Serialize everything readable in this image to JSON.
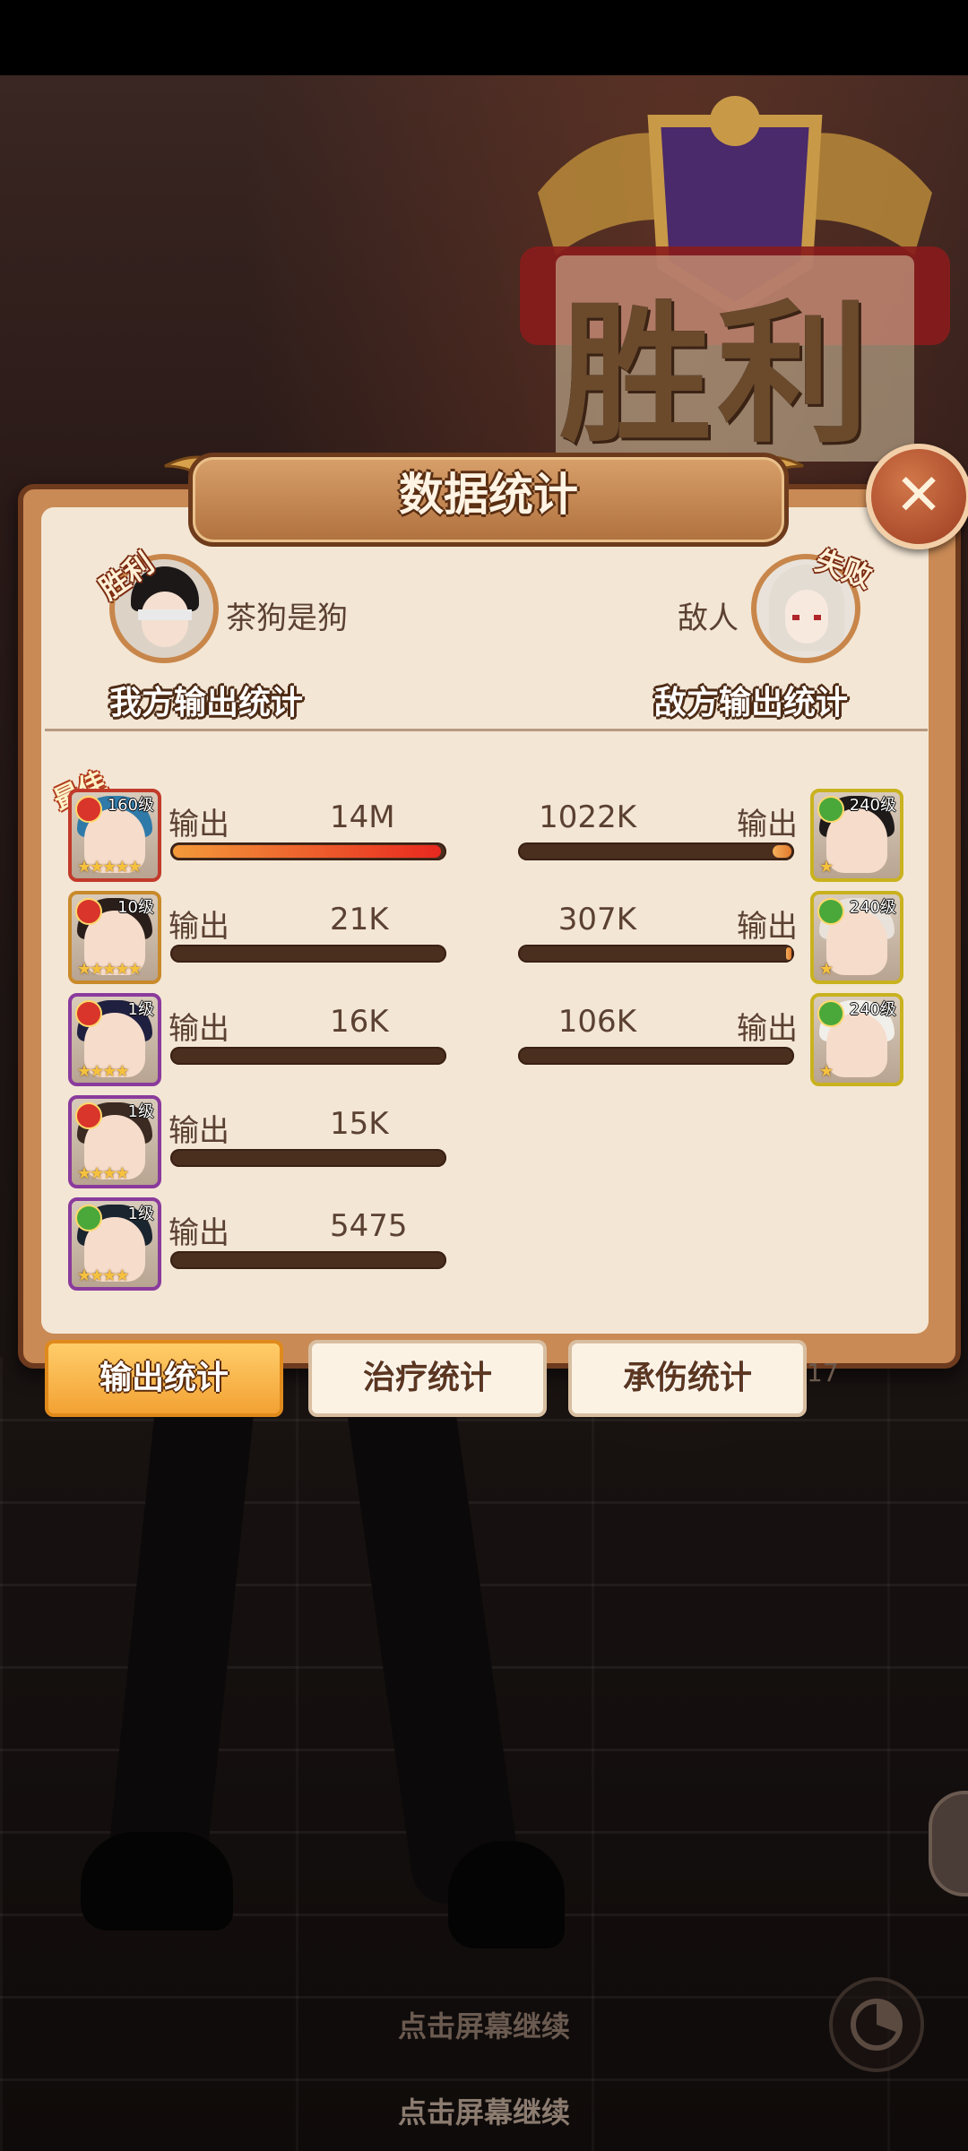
{
  "header": {
    "victory_text": "胜利",
    "panel_title": "数据统计",
    "close_symbol": "✕"
  },
  "players": {
    "ally": {
      "name": "茶狗是狗",
      "badge": "胜利",
      "section_title": "我方输出统计"
    },
    "enemy": {
      "name": "敌人",
      "badge": "失败",
      "section_title": "敌方输出统计"
    }
  },
  "best_tag": "最佳",
  "output_label": "输出",
  "ally_heroes": [
    {
      "level": "160级",
      "stars": "★★★★★",
      "value": "14M",
      "fill": 0.99,
      "frame": "#c23a2b",
      "hair": "#2f7aa8",
      "elem": "#d9352a"
    },
    {
      "level": "10级",
      "stars": "★★★★★",
      "value": "21K",
      "fill": 0.0,
      "frame": "#c98a2b",
      "hair": "#2a1e1a",
      "elem": "#d9352a"
    },
    {
      "level": "1级",
      "stars": "★★★★",
      "value": "16K",
      "fill": 0.0,
      "frame": "#8a3a9c",
      "hair": "#1f2040",
      "elem": "#d9352a"
    },
    {
      "level": "1级",
      "stars": "★★★★",
      "value": "15K",
      "fill": 0.0,
      "frame": "#8a3a9c",
      "hair": "#3b2a22",
      "elem": "#d9352a"
    },
    {
      "level": "1级",
      "stars": "★★★★",
      "value": "5475",
      "fill": 0.0,
      "frame": "#8a3a9c",
      "hair": "#1a2530",
      "elem": "#4aa83a"
    }
  ],
  "enemy_heroes": [
    {
      "level": "240级",
      "stars": "★",
      "value": "1022K",
      "fill": 0.07,
      "frame": "#c9b21e",
      "hair": "#1e1a1a",
      "elem": "#4aa83a"
    },
    {
      "level": "240级",
      "stars": "★",
      "value": "307K",
      "fill": 0.02,
      "frame": "#c9b21e",
      "hair": "#e8e2da",
      "elem": "#4aa83a"
    },
    {
      "level": "240级",
      "stars": "★",
      "value": "106K",
      "fill": 0.0,
      "frame": "#c9b21e",
      "hair": "#f1efea",
      "elem": "#4aa83a"
    }
  ],
  "tabs": [
    {
      "label": "输出统计",
      "active": true
    },
    {
      "label": "治疗统计",
      "active": false
    },
    {
      "label": "承伤统计",
      "active": false
    }
  ],
  "turn_number": "17",
  "continue_text": "点击屏幕继续",
  "continue_text_bottom": "点击屏幕继续"
}
